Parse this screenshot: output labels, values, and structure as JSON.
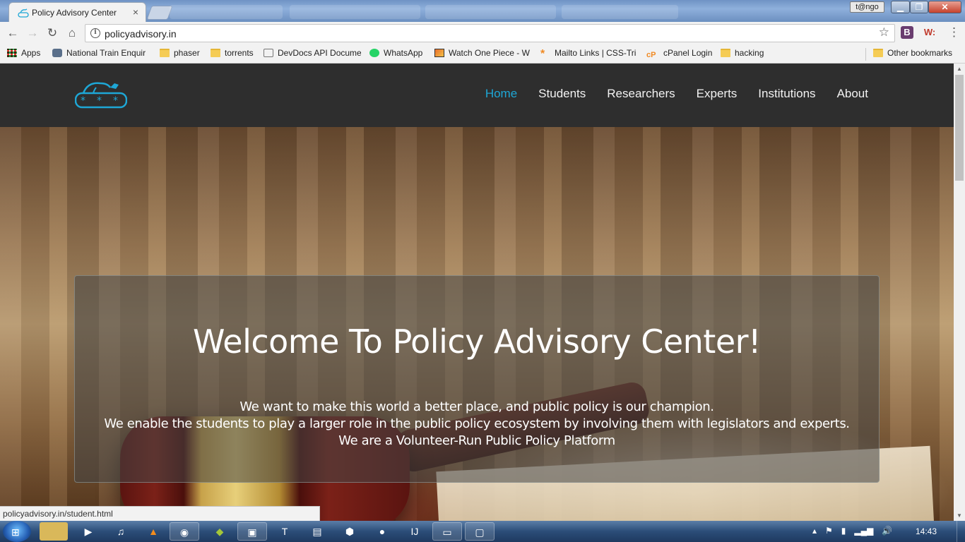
{
  "browser": {
    "active_tab": {
      "title": "Policy Advisory Center",
      "close": "×"
    },
    "profile_name": "t@ngo",
    "window_buttons": {
      "minimize": "▁",
      "maximize": "❐",
      "close": "✕"
    },
    "url": "policyadvisory.in",
    "extensions": {
      "b": "B",
      "w": "W:"
    },
    "menu_icon": "⋮",
    "nav_icons": {
      "back": "←",
      "forward": "→",
      "reload": "↻",
      "home": "⌂"
    },
    "star_icon": "☆"
  },
  "bookmarks": [
    {
      "label": "Apps",
      "icon": "apps-grid-icon"
    },
    {
      "label": "National Train Enquir",
      "icon": "train-icon"
    },
    {
      "label": "phaser",
      "icon": "folder-icon"
    },
    {
      "label": "torrents",
      "icon": "folder-icon"
    },
    {
      "label": "DevDocs API Docume",
      "icon": "devdocs-icon"
    },
    {
      "label": "WhatsApp",
      "icon": "whatsapp-icon"
    },
    {
      "label": "Watch One Piece - W",
      "icon": "video-icon"
    },
    {
      "label": "Mailto Links | CSS-Tri",
      "icon": "asterisk-icon"
    },
    {
      "label": "cPanel Login",
      "icon": "cpanel-icon"
    },
    {
      "label": "hacking",
      "icon": "folder-icon"
    }
  ],
  "other_bookmarks": "Other bookmarks",
  "site": {
    "nav": [
      {
        "label": "Home",
        "active": true
      },
      {
        "label": "Students",
        "active": false
      },
      {
        "label": "Researchers",
        "active": false
      },
      {
        "label": "Experts",
        "active": false
      },
      {
        "label": "Institutions",
        "active": false
      },
      {
        "label": "About",
        "active": false
      }
    ],
    "hero": {
      "heading": "Welcome To Policy Advisory Center!",
      "lines": [
        "We want to make this world a better place, and public policy is our champion.",
        "We enable the students to play a larger role in the public policy ecosystem by involving them with legislators and experts.",
        "We are a Volunteer-Run Public Policy Platform"
      ]
    },
    "accent_color": "#1ea7d6"
  },
  "status_url": "policyadvisory.in/student.html",
  "taskbar": {
    "clock": "14:43",
    "tray_icons": [
      "▴",
      "⚑",
      "▮",
      "▂▄▆",
      "🔊"
    ]
  }
}
